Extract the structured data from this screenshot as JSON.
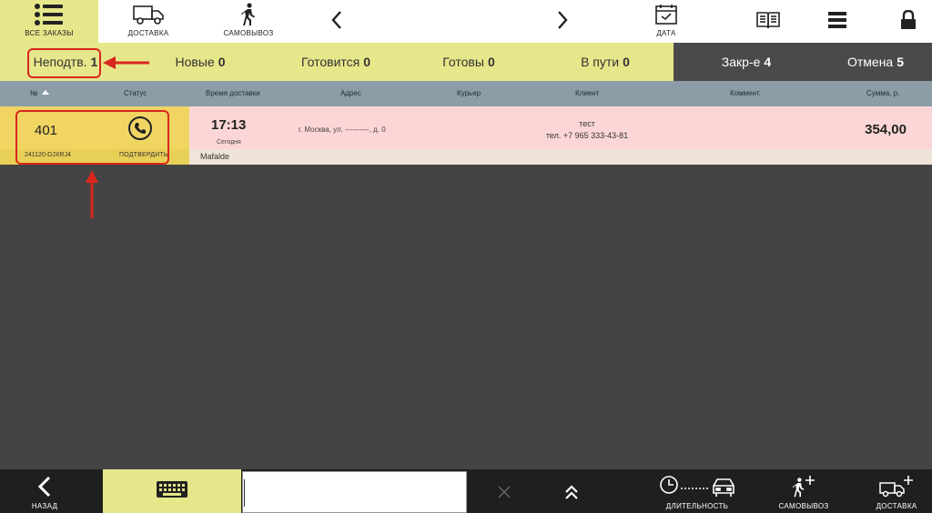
{
  "toolbar": {
    "all_orders": "ВСЕ ЗАКАЗЫ",
    "delivery": "ДОСТАВКА",
    "pickup": "САМОВЫВОЗ",
    "date": "ДАТА"
  },
  "tabs": [
    {
      "label": "Неподтв.",
      "count": "1"
    },
    {
      "label": "Новые",
      "count": "0"
    },
    {
      "label": "Готовится",
      "count": "0"
    },
    {
      "label": "Готовы",
      "count": "0"
    },
    {
      "label": "В пути",
      "count": "0"
    },
    {
      "label": "Закр-е",
      "count": "4"
    },
    {
      "label": "Отмена",
      "count": "5"
    }
  ],
  "columns": {
    "number": "№",
    "status": "Статус",
    "delivery_time": "Время доставки",
    "address": "Адрес",
    "courier": "Курьер",
    "client": "Клиент",
    "comment": "Коммент.",
    "sum": "Сумма, р."
  },
  "order": {
    "number": "401",
    "code": "241120-DJXRJ4",
    "confirm": "ПОДТВЕРДИТЬ",
    "time": "17:13",
    "day": "Сегодня",
    "address": "г. Москва, ул. ----------, д. 0",
    "client_name": "тест",
    "client_phone": "тел. +7 965 333-43-81",
    "sum": "354,00",
    "comment": "Mafalde"
  },
  "bottom": {
    "back": "НАЗАД",
    "duration": "ДЛИТЕЛЬНОСТЬ",
    "pickup": "САМОВЫВОЗ",
    "delivery": "ДОСТАВКА",
    "search_value": ""
  },
  "colors": {
    "accent": "#e6e68a",
    "order_left": "#f0d563",
    "order_row": "#fcd6d6",
    "annotation": "#d9261c"
  }
}
